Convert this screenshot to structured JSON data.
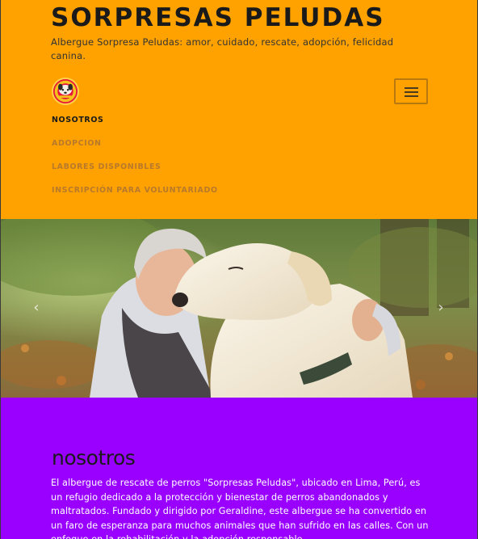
{
  "header": {
    "site_title": "SORPRESAS PELUDAS",
    "tagline": "Albergue Sorpresa Peludas: amor, cuidado, rescate, adopción, felicidad canina.",
    "logo_icon": "dog-logo-icon",
    "menu_icon": "hamburger-menu-icon",
    "background_color": "#ffa200"
  },
  "nav": {
    "items": [
      {
        "label": "NOSOTROS",
        "active": true
      },
      {
        "label": "ADOPCION",
        "active": false
      },
      {
        "label": "LABORES DISPONIBLES",
        "active": false
      },
      {
        "label": "INSCRIPCIÓN PARA VOLUNTARIADO",
        "active": false
      }
    ]
  },
  "hero": {
    "prev_icon": "chevron-left-icon",
    "next_icon": "chevron-right-icon",
    "image": "woman-hugging-dog-photo"
  },
  "about": {
    "heading": "nosotros",
    "body": "El albergue de rescate de perros \"Sorpresas Peludas\", ubicado en Lima, Perú, es un refugio dedicado a la protección y bienestar de perros abandonados y maltratados. Fundado y dirigido por Geraldine, este albergue se ha convertido en un faro de esperanza para muchos animales que han sufrido en las calles. Con un enfoque en la rehabilitación y la adopción responsable,",
    "background_color": "#9900ff"
  }
}
